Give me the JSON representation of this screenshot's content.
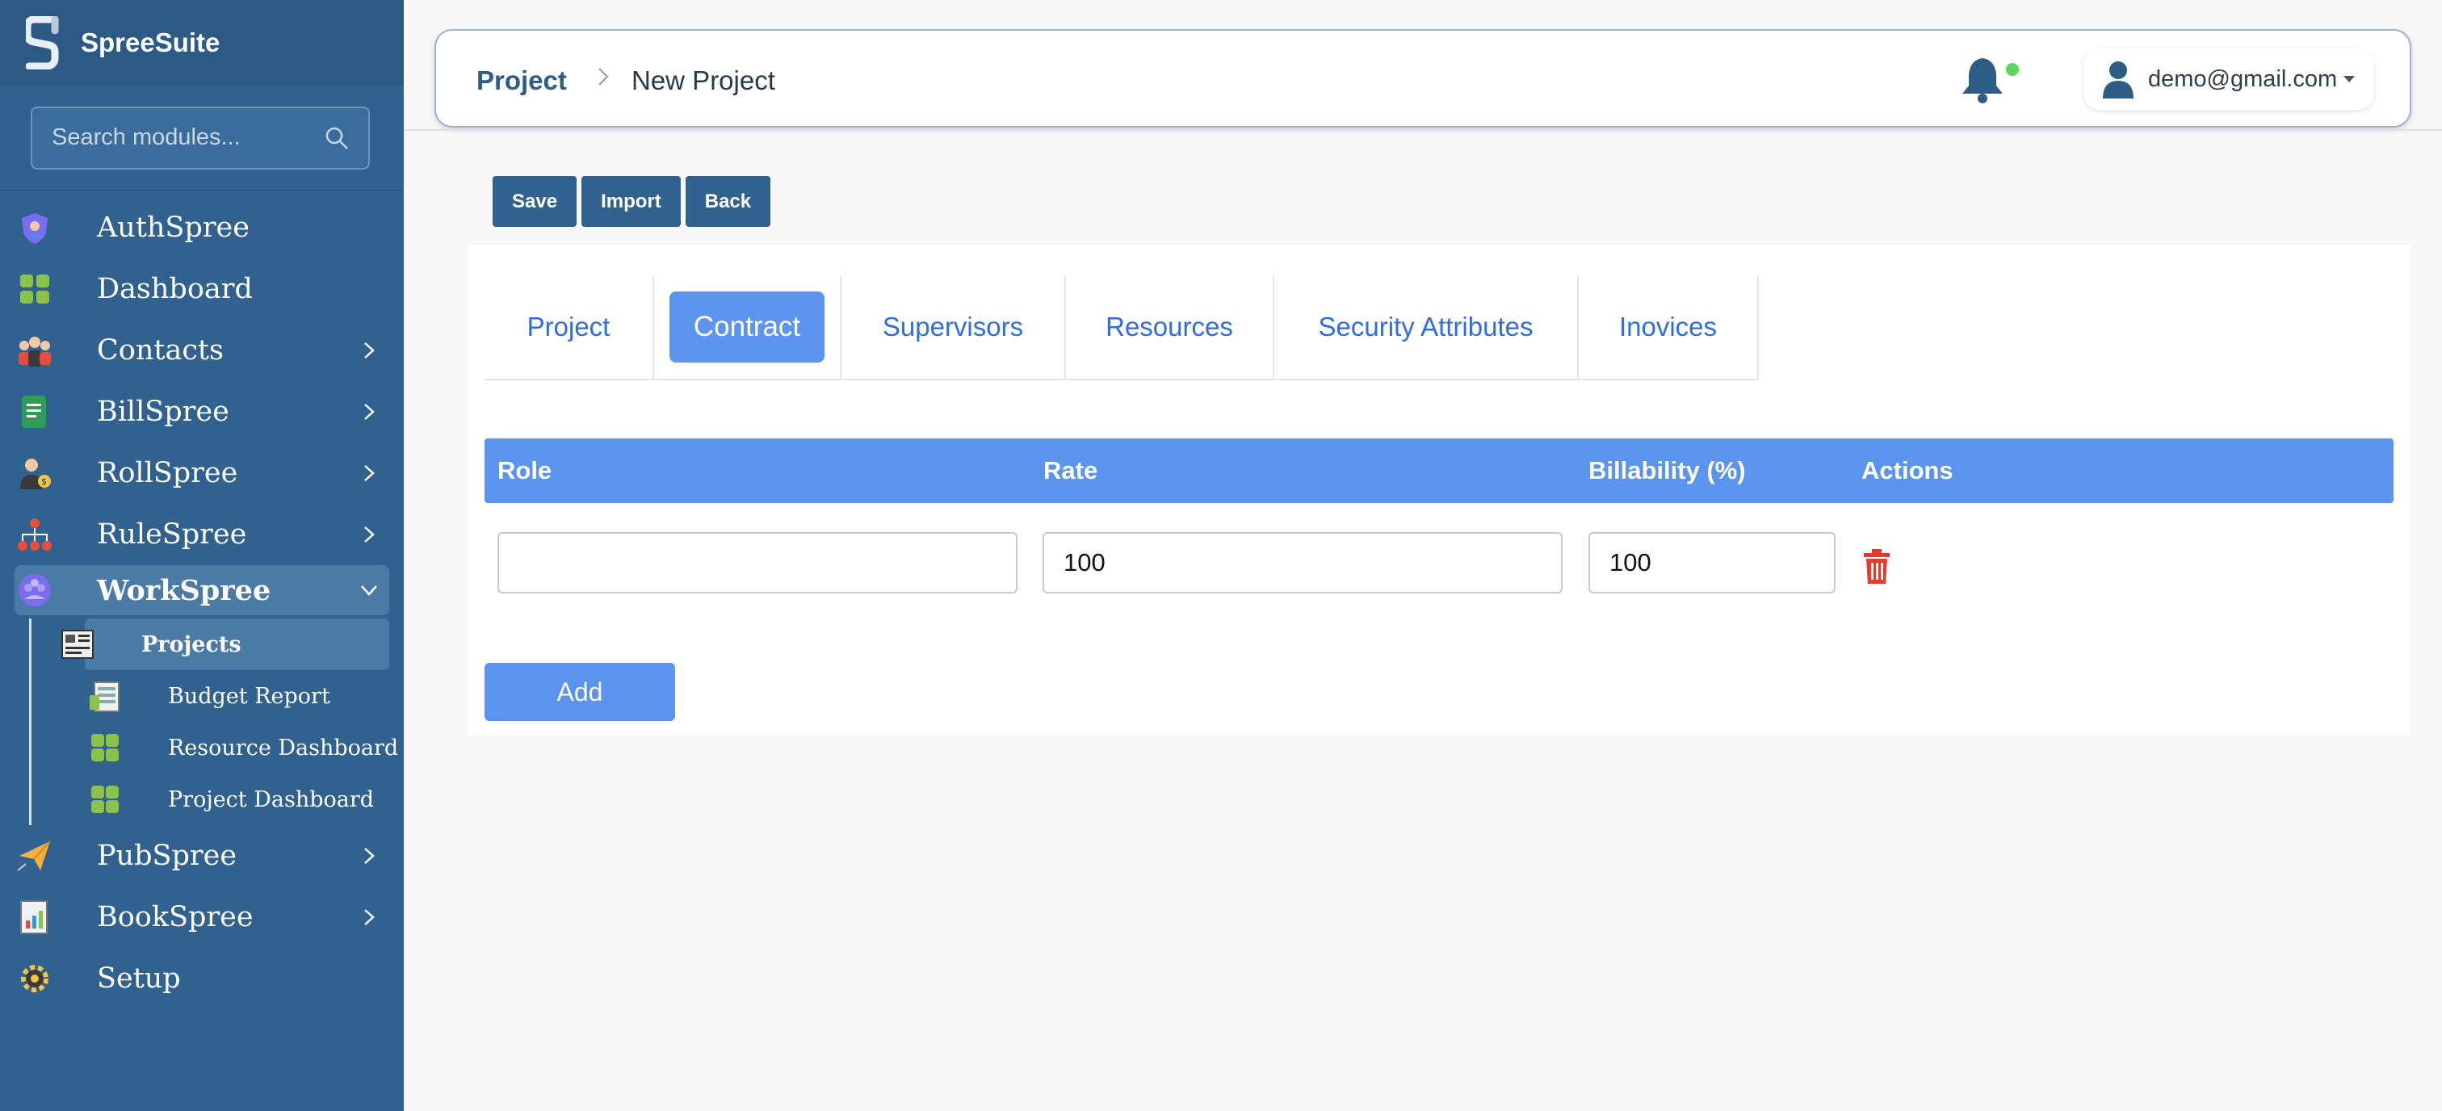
{
  "app": {
    "name": "SpreeSuite"
  },
  "search": {
    "placeholder": "Search modules..."
  },
  "sidebar": {
    "items": [
      {
        "label": "AuthSpree",
        "icon": "shield-people-icon"
      },
      {
        "label": "Dashboard",
        "icon": "dashboard-grid-icon"
      },
      {
        "label": "Contacts",
        "icon": "contacts-group-icon"
      },
      {
        "label": "BillSpree",
        "icon": "bill-document-icon"
      },
      {
        "label": "RollSpree",
        "icon": "payroll-person-icon"
      },
      {
        "label": "RuleSpree",
        "icon": "hierarchy-icon"
      },
      {
        "label": "WorkSpree",
        "icon": "work-team-icon"
      },
      {
        "label": "PubSpree",
        "icon": "paper-plane-icon"
      },
      {
        "label": "BookSpree",
        "icon": "book-report-icon"
      },
      {
        "label": "Setup",
        "icon": "gear-icon"
      }
    ],
    "workspree_sub": [
      {
        "label": "Projects",
        "icon": "projects-board-icon"
      },
      {
        "label": "Budget Report",
        "icon": "budget-sheet-icon"
      },
      {
        "label": "Resource Dashboard",
        "icon": "dashboard-grid-icon"
      },
      {
        "label": "Project Dashboard",
        "icon": "dashboard-grid-icon"
      }
    ]
  },
  "header": {
    "breadcrumb_root": "Project",
    "breadcrumb_current": "New Project",
    "user_email": "demo@gmail.com"
  },
  "toolbar": {
    "save": "Save",
    "import": "Import",
    "back": "Back"
  },
  "tabs": [
    "Project",
    "Contract",
    "Supervisors",
    "Resources",
    "Security Attributes",
    "Inovices"
  ],
  "active_tab": "Contract",
  "table": {
    "columns": [
      "Role",
      "Rate",
      "Billability (%)",
      "Actions"
    ],
    "rows": [
      {
        "role": "",
        "rate": "100",
        "billability": "100"
      }
    ]
  },
  "add_label": "Add",
  "colors": {
    "sidebar": "#31628f",
    "accent": "#5b93ee",
    "tab_text": "#2f6ee0",
    "delete": "#e53b2c"
  }
}
